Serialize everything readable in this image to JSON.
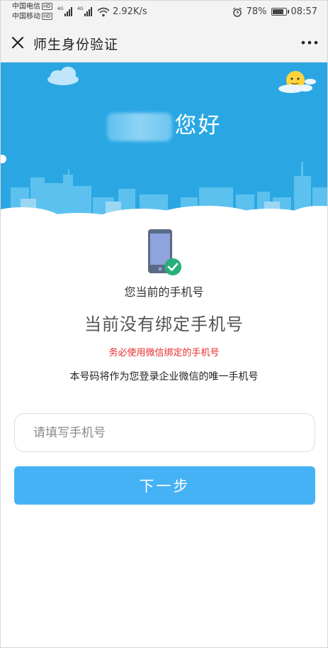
{
  "status_bar": {
    "carrier_1": "中国电信",
    "carrier_2": "中国移动",
    "hd_badge": "HD",
    "network": "4G",
    "speed": "2.92K/s",
    "battery": "78%",
    "battery_level": 0.78,
    "time": "08:57",
    "icons": [
      "signal-icon",
      "wifi-icon",
      "alarm-icon",
      "battery-icon"
    ]
  },
  "title_bar": {
    "title": "师生身份验证",
    "close_icon": "close-icon",
    "more_icon": "more-icon"
  },
  "hero": {
    "greeting": "您好",
    "bg_color": "#2aa7e3"
  },
  "phone_section": {
    "label": "您当前的手机号",
    "status": "当前没有绑定手机号",
    "warning": "务必使用微信绑定的手机号",
    "description": "本号码将作为您登录企业微信的唯一手机号",
    "warning_color": "#e82c2c"
  },
  "form": {
    "phone_placeholder": "请填写手机号",
    "phone_value": "",
    "next_label": "下一步",
    "button_color": "#45b2f5"
  }
}
